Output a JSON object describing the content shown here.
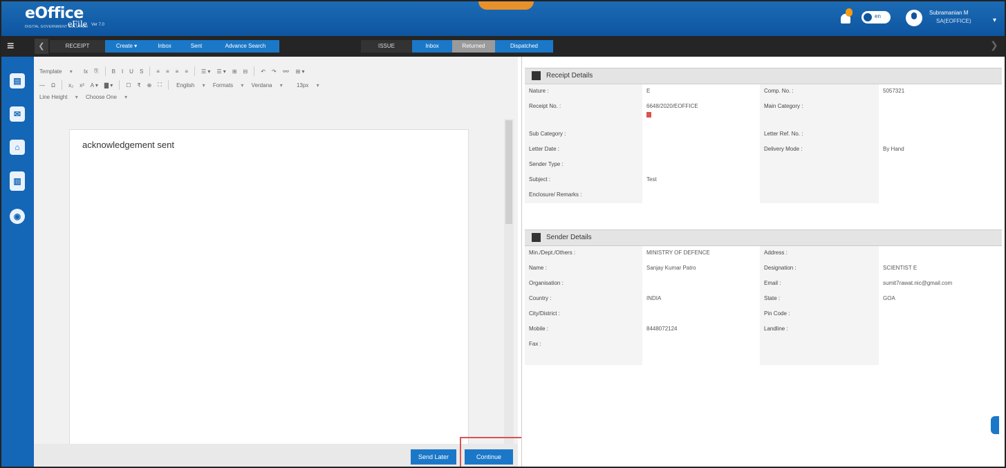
{
  "header": {
    "logo": "eOffice",
    "logo_tagline": "DIGITAL GOVERNMENT SOLUTION",
    "app_name": "eFile",
    "version": "Ver 7.0",
    "toggle_label": "en",
    "user_name": "Subramanian M",
    "user_role": "SA(EOFFICE)"
  },
  "nav": {
    "receipt": "RECEIPT",
    "create": "Create ▾",
    "inbox": "Inbox",
    "sent": "Sent",
    "advance_search": "Advance Search",
    "issue": "ISSUE",
    "issue_inbox": "Inbox",
    "returned": "Returned",
    "dispatched": "Dispatched"
  },
  "toolbar": {
    "template": "Template",
    "row1": [
      "Ix",
      "⎘",
      "B",
      "I",
      "U",
      "S",
      "≡",
      "≡",
      "≡",
      "≡",
      "☰ ▾",
      "☰ ▾",
      "⊞",
      "⊟",
      "↶",
      "↷",
      "👓",
      "⊞ ▾"
    ],
    "row2": [
      "—",
      "Ω",
      "x₂",
      "x²",
      "A ▾",
      "▇ ▾",
      "☐",
      "₹",
      "⊕",
      "⛶"
    ],
    "english": "English",
    "formats": "Formats",
    "verdana": "Verdana",
    "size": "13px",
    "line_height": "Line Height",
    "choose_one": "Choose One"
  },
  "editor": {
    "content": "acknowledgement sent"
  },
  "buttons": {
    "send_later": "Send Later",
    "continue": "Continue"
  },
  "receipt_details": {
    "title": "Receipt Details",
    "rows": [
      {
        "l1": "Nature :",
        "v1": "E",
        "l2": "Comp. No. :",
        "v2": "5057321"
      },
      {
        "l1": "Receipt No. :",
        "v1": "6648/2020/EOFFICE",
        "l2": "Main Category :",
        "v2": ""
      },
      {
        "l1": "Sub Category :",
        "v1": "",
        "l2": "Letter Ref. No. :",
        "v2": ""
      },
      {
        "l1": "Letter Date :",
        "v1": "",
        "l2": "Delivery Mode :",
        "v2": "By Hand"
      },
      {
        "l1": "Sender Type :",
        "v1": "",
        "l2": "",
        "v2": ""
      },
      {
        "l1": "Subject :",
        "v1": "Test",
        "l2": "",
        "v2": ""
      },
      {
        "l1": "Enclosure/ Remarks :",
        "v1": "",
        "l2": "",
        "v2": ""
      }
    ]
  },
  "sender_details": {
    "title": "Sender Details",
    "rows": [
      {
        "l1": "Min./Dept./Others :",
        "v1": "MINISTRY OF DEFENCE",
        "l2": "Address :",
        "v2": ""
      },
      {
        "l1": "Name :",
        "v1": "Sanjay Kumar Patro",
        "l2": "Designation :",
        "v2": "SCIENTIST E"
      },
      {
        "l1": "Organisation :",
        "v1": "",
        "l2": "Email :",
        "v2": "sumit7rawat.nic@gmail.com"
      },
      {
        "l1": "Country :",
        "v1": "INDIA",
        "l2": "State :",
        "v2": "GOA"
      },
      {
        "l1": "City/District :",
        "v1": "",
        "l2": "Pin Code :",
        "v2": ""
      },
      {
        "l1": "Mobile :",
        "v1": "8448072124",
        "l2": "Landline :",
        "v2": ""
      },
      {
        "l1": "Fax :",
        "v1": "",
        "l2": "",
        "v2": ""
      }
    ]
  },
  "colors": {
    "header_blue": "#0e55a0",
    "nav_dark": "#252525",
    "button_blue": "#1b78c8",
    "highlight_red": "#d9534f"
  }
}
